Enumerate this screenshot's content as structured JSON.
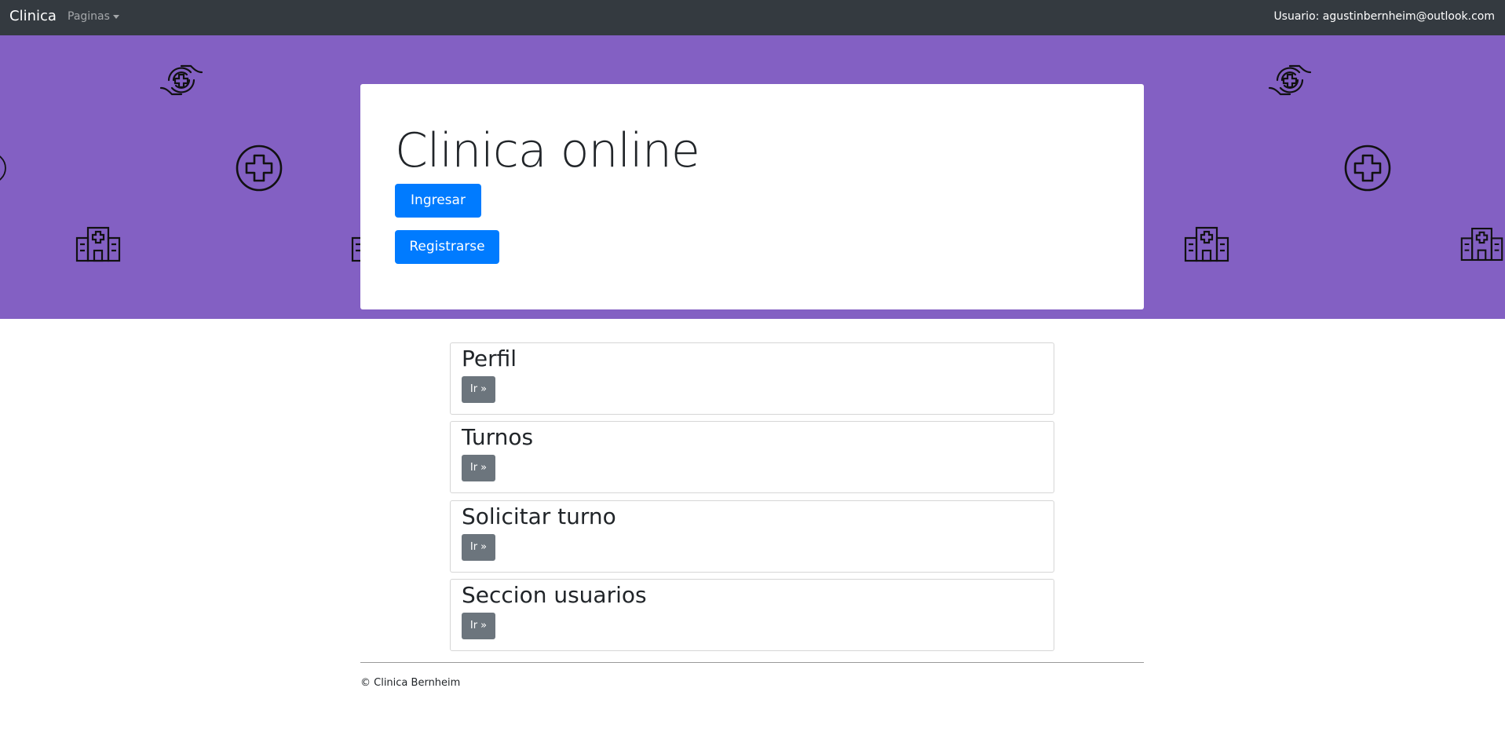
{
  "navbar": {
    "brand": "Clinica",
    "dropdown_label": "Paginas",
    "user_label": "Usuario: agustinbernheim@outlook.com"
  },
  "hero": {
    "background_color": "#8360c3",
    "title": "Clinica online",
    "buttons": {
      "login": "Ingresar »",
      "register": "Registrarse »"
    },
    "pattern_icons": [
      "hands-cross-icon",
      "medical-cross-circle-icon",
      "hospital-building-icon"
    ]
  },
  "cards": [
    {
      "title": "Perfil",
      "button": "Ir »"
    },
    {
      "title": "Turnos",
      "button": "Ir »"
    },
    {
      "title": "Solicitar turno",
      "button": "Ir »"
    },
    {
      "title": "Seccion usuarios",
      "button": "Ir »"
    }
  ],
  "footer": {
    "text": "© Clinica Bernheim"
  },
  "colors": {
    "navbar": "#343a40",
    "primary": "#007bff",
    "secondary": "#6c757d"
  }
}
